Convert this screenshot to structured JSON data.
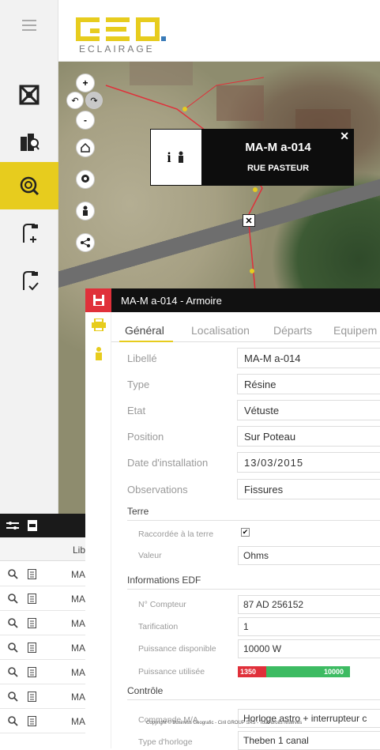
{
  "logo": {
    "main": "GEO.",
    "sub": "ECLAIRAGE"
  },
  "sidebar": {
    "items": [
      {
        "name": "menu",
        "icon": "hamburger-icon"
      },
      {
        "name": "network",
        "icon": "network-icon"
      },
      {
        "name": "buildings-search",
        "icon": "building-search-icon"
      },
      {
        "name": "lamp-search",
        "icon": "lamp-search-icon",
        "active": true
      },
      {
        "name": "lamp-add",
        "icon": "lamp-add-icon"
      },
      {
        "name": "lamp-check",
        "icon": "lamp-check-icon"
      }
    ],
    "accent": "#e7cc1e"
  },
  "map": {
    "zoom_in": "+",
    "zoom_out": "-",
    "popup": {
      "title": "MA-M a-014",
      "subtitle": "RUE PASTEUR",
      "close": "✕"
    }
  },
  "list": {
    "header_col": "Lib",
    "rows": [
      "MA",
      "MA",
      "MA",
      "MA",
      "MA",
      "MA",
      "MA"
    ]
  },
  "panel": {
    "title": "MA-M a-014 - Armoire",
    "tabs": [
      "Général",
      "Localisation",
      "Départs",
      "Equipem"
    ],
    "fields": [
      {
        "label": "Libellé",
        "value": "MA-M a-014"
      },
      {
        "label": "Type",
        "value": "Résine"
      },
      {
        "label": "Etat",
        "value": "Vétuste"
      },
      {
        "label": "Position",
        "value": "Sur Poteau"
      },
      {
        "label": "Date d'installation",
        "value": "13/03/2015"
      },
      {
        "label": "Observations",
        "value": "Fissures"
      }
    ],
    "terre": {
      "section": "Terre",
      "raccordee_label": "Raccordée à la terre",
      "valeur_label": "Valeur",
      "valeur": "Ohms"
    },
    "edf": {
      "section": "Informations EDF",
      "compteur_label": "N° Compteur",
      "compteur": "87 AD 256152",
      "tarif_label": "Tarification",
      "tarif": "1",
      "pdispo_label": "Puissance disponible",
      "pdispo": "10000 W",
      "putil_label": "Puissance utilisée",
      "putil_used": "1350",
      "putil_max": "10000",
      "putil_fraction": 0.135
    },
    "controle": {
      "section": "Contrôle",
      "commande_label": "Commande M/A",
      "commande": "Horloge astro + interrupteur c",
      "horloge_label": "Type d'horloge",
      "horloge": "Theben 1 canal"
    }
  },
  "copyright": "Copyright © Business Geografic - Ciril GROUP SAS - Tous droits réservés"
}
